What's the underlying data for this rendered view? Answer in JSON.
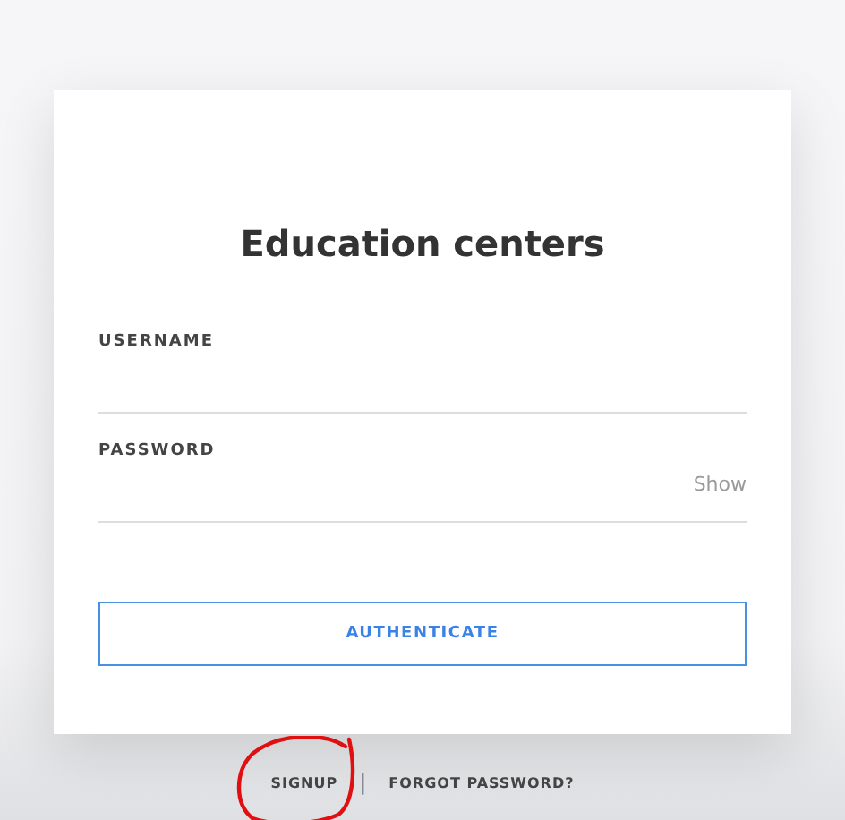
{
  "title": "Education centers",
  "fields": [
    {
      "label": "USERNAME"
    },
    {
      "label": "PASSWORD",
      "toggle": "Show"
    }
  ],
  "submit": "AUTHENTICATE",
  "links": [
    "SIGNUP",
    "FORGOT PASSWORD?"
  ],
  "separator": "|"
}
